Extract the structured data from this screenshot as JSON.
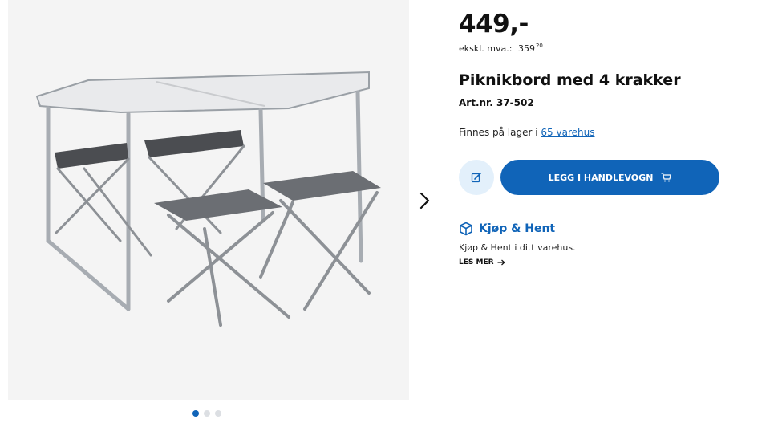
{
  "product": {
    "price": "449,-",
    "vat_label": "ekskl. mva.:",
    "vat_value": "359",
    "vat_decimals": "20",
    "title": "Piknikbord med 4 krakker",
    "article_number": "Art.nr. 37-502",
    "stock_prefix": "Finnes på lager i",
    "stock_link": "65 varehus"
  },
  "actions": {
    "edit_icon": "pencil-note-icon",
    "cart_label": "LEGG I HANDLEVOGN",
    "cart_icon": "shopping-cart-icon"
  },
  "pickup": {
    "icon": "box-icon",
    "title": "Kjøp & Hent",
    "description": "Kjøp & Hent i ditt varehus.",
    "read_more": "LES MER"
  },
  "gallery": {
    "image_alt": "Folding picnic table with four stools",
    "current_slide": 1,
    "total_slides": 3
  },
  "colors": {
    "accent": "#1064b8",
    "edit_button_bg": "#e3f0fb"
  }
}
